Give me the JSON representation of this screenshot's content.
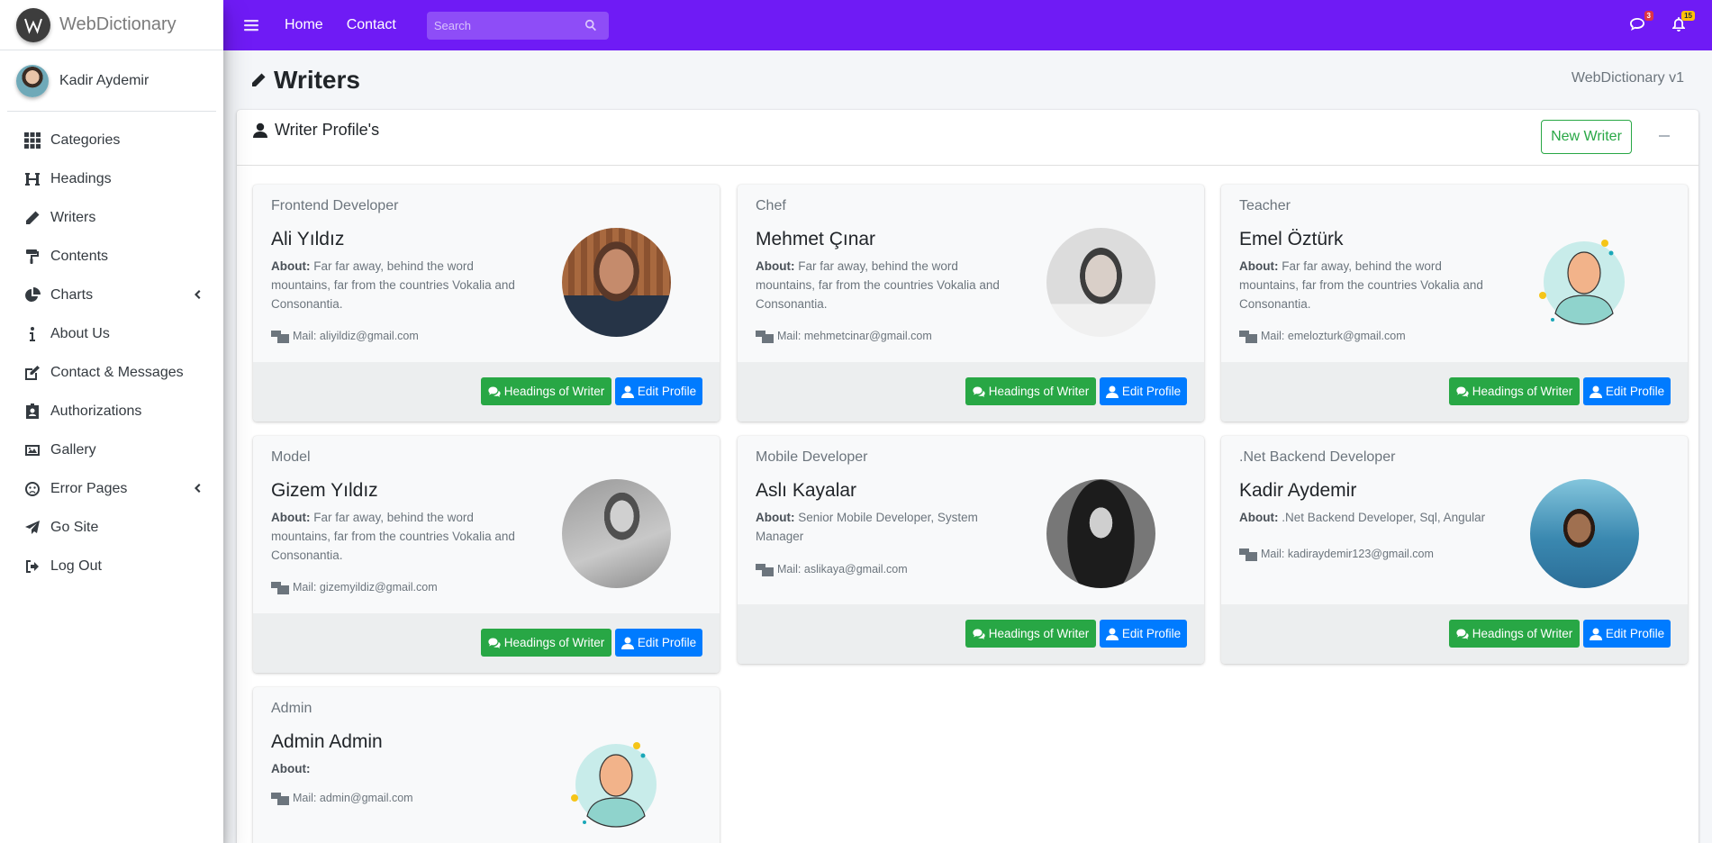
{
  "brand": {
    "name": "WebDictionary"
  },
  "user": {
    "name": "Kadir Aydemir"
  },
  "sidebar": {
    "items": [
      {
        "label": "Categories",
        "icon": "grid-icon"
      },
      {
        "label": "Headings",
        "icon": "heading-icon"
      },
      {
        "label": "Writers",
        "icon": "pen-icon"
      },
      {
        "label": "Contents",
        "icon": "paint-roller-icon"
      },
      {
        "label": "Charts",
        "icon": "chart-pie-icon",
        "has_submenu": true
      },
      {
        "label": "About Us",
        "icon": "info-icon"
      },
      {
        "label": "Contact & Messages",
        "icon": "edit-icon"
      },
      {
        "label": "Authorizations",
        "icon": "id-badge-icon"
      },
      {
        "label": "Gallery",
        "icon": "image-icon"
      },
      {
        "label": "Error Pages",
        "icon": "sad-face-icon",
        "has_submenu": true
      },
      {
        "label": "Go Site",
        "icon": "paper-plane-icon"
      },
      {
        "label": "Log Out",
        "icon": "sign-out-icon"
      }
    ]
  },
  "topbar": {
    "links": [
      "Home",
      "Contact"
    ],
    "search_placeholder": "Search",
    "messages_badge": "3",
    "notifications_badge": "15",
    "accent_color": "#6f1bf5"
  },
  "header": {
    "title": "Writers",
    "breadcrumb": "WebDictionary v1"
  },
  "card": {
    "title": "Writer Profile's",
    "new_button": "New Writer"
  },
  "writers": [
    {
      "role": "Frontend Developer",
      "name": "Ali Yıldız",
      "about_label": "About:",
      "about": "Far far away, behind the word mountains, far from the countries Vokalia and Consonantia.",
      "mail": "Mail: aliyildiz@gmail.com",
      "headings_button": "Headings of Writer",
      "edit_button": "Edit Profile"
    },
    {
      "role": "Chef",
      "name": "Mehmet Çınar",
      "about_label": "About:",
      "about": "Far far away, behind the word mountains, far from the countries Vokalia and Consonantia.",
      "mail": "Mail: mehmetcinar@gmail.com",
      "headings_button": "Headings of Writer",
      "edit_button": "Edit Profile"
    },
    {
      "role": "Teacher",
      "name": "Emel Öztürk",
      "about_label": "About:",
      "about": "Far far away, behind the word mountains, far from the countries Vokalia and Consonantia.",
      "mail": "Mail: emelozturk@gmail.com",
      "headings_button": "Headings of Writer",
      "edit_button": "Edit Profile"
    },
    {
      "role": "Model",
      "name": "Gizem Yıldız",
      "about_label": "About:",
      "about": "Far far away, behind the word mountains, far from the countries Vokalia and Consonantia.",
      "mail": "Mail: gizemyildiz@gmail.com",
      "headings_button": "Headings of Writer",
      "edit_button": "Edit Profile"
    },
    {
      "role": "Mobile Developer",
      "name": "Aslı Kayalar",
      "about_label": "About:",
      "about": "Senior Mobile Developer, System Manager",
      "mail": "Mail: aslikaya@gmail.com",
      "headings_button": "Headings of Writer",
      "edit_button": "Edit Profile"
    },
    {
      "role": ".Net Backend Developer",
      "name": "Kadir Aydemir",
      "about_label": "About:",
      "about": ".Net Backend Developer, Sql, Angular",
      "mail": "Mail: kadiraydemir123@gmail.com",
      "headings_button": "Headings of Writer",
      "edit_button": "Edit Profile"
    },
    {
      "role": "Admin",
      "name": "Admin Admin",
      "about_label": "About:",
      "about": "",
      "mail": "Mail: admin@gmail.com"
    }
  ]
}
